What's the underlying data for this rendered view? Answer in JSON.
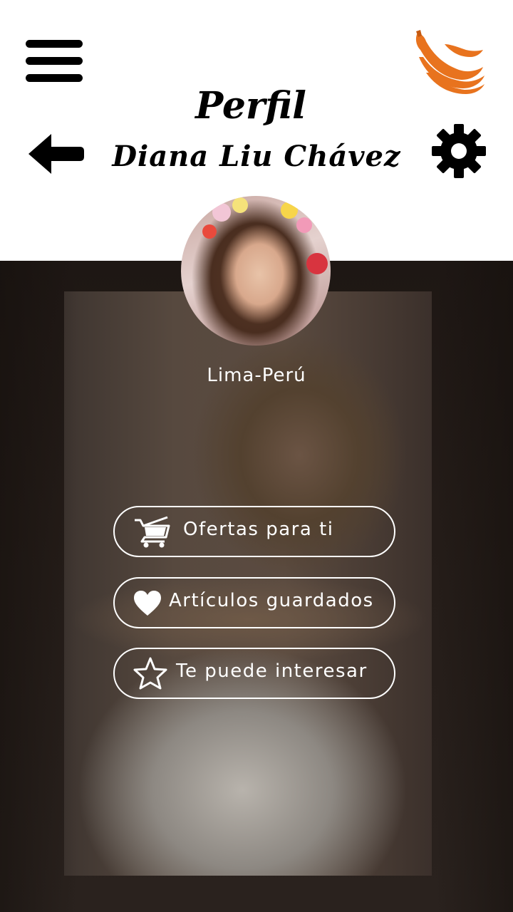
{
  "header": {
    "title": "Perfil",
    "name": "Diana Liu Chávez",
    "icons": {
      "menu": "hamburger-menu-icon",
      "back": "arrow-left-icon",
      "settings": "gear-icon",
      "logo": "banana-logo-icon"
    },
    "logo_color": "#E8731E"
  },
  "profile": {
    "location": "Lima-Perú"
  },
  "menu": {
    "items": [
      {
        "label": "Ofertas para ti",
        "icon": "cart-icon"
      },
      {
        "label": "Artículos guardados",
        "icon": "heart-icon"
      },
      {
        "label": "Te puede interesar",
        "icon": "star-icon"
      }
    ]
  }
}
